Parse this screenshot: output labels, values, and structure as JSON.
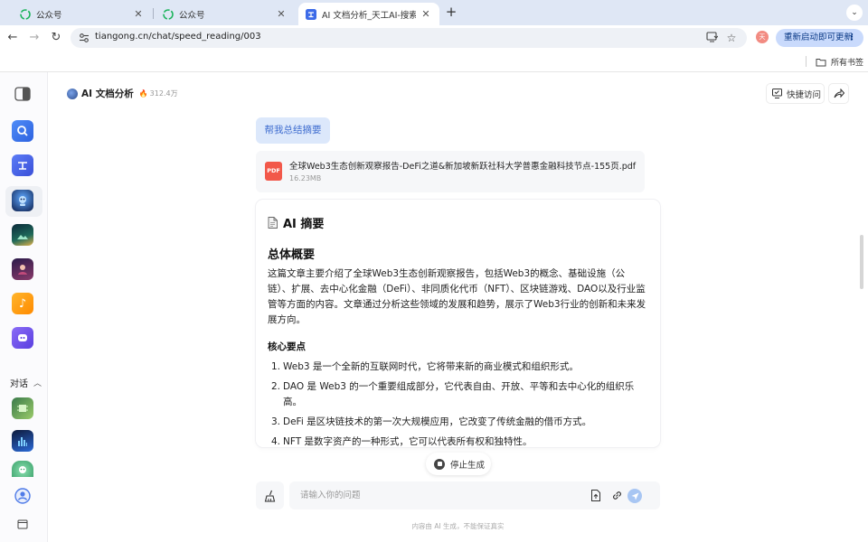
{
  "browser": {
    "tabs": [
      {
        "title": "公众号",
        "active": false
      },
      {
        "title": "公众号",
        "active": false
      },
      {
        "title": "AI 文档分析_天工AI-搜索、对话",
        "active": true
      }
    ],
    "url": "tiangong.cn/chat/speed_reading/003",
    "profile_initial": "天",
    "relaunch_label": "重新启动即可更新",
    "bookmarks_folder": "所有书签"
  },
  "sidebar": {
    "section_label": "对话"
  },
  "header": {
    "app_name": "AI 文档分析",
    "hot_count": "312.4万",
    "quick_access_label": "快捷访问"
  },
  "conversation": {
    "user_prompt": "帮我总结摘要",
    "file": {
      "type_label": "PDF",
      "name": "全球Web3生态创新观察报告-DeFi之道&新加坡新跃社科大学普惠金融科技节点-155页.pdf",
      "size": "16.23MB"
    },
    "answer": {
      "title": "AI 摘要",
      "overview_heading": "总体概要",
      "overview_text": "这篇文章主要介绍了全球Web3生态创新观察报告，包括Web3的概念、基础设施（公链）、扩展、去中心化金融（DeFi）、非同质化代币（NFT）、区块链游戏、DAO以及行业监管等方面的内容。文章通过分析这些领域的发展和趋势，展示了Web3行业的创新和未来发展方向。",
      "key_points_heading": "核心要点",
      "key_points": [
        {
          "num": "1.",
          "text": "Web3 是一个全新的互联网时代，它将带来新的商业模式和组织形式。"
        },
        {
          "num": "2.",
          "text": "DAO 是 Web3 的一个重要组成部分，它代表自由、开放、平等和去中心化的组织乐高。"
        },
        {
          "num": "3.",
          "text": "DeFi 是区块链技术的第一次大规模应用，它改变了传统金融的借币方式。"
        },
        {
          "num": "4.",
          "text": "NFT 是数字资产的一种形式，它可以代表所有权和独特性。"
        }
      ]
    }
  },
  "stop_label": "停止生成",
  "input": {
    "placeholder": "请输入你的问题",
    "value": ""
  },
  "disclaimer": "内容由 AI 生成，不能保证真实"
}
